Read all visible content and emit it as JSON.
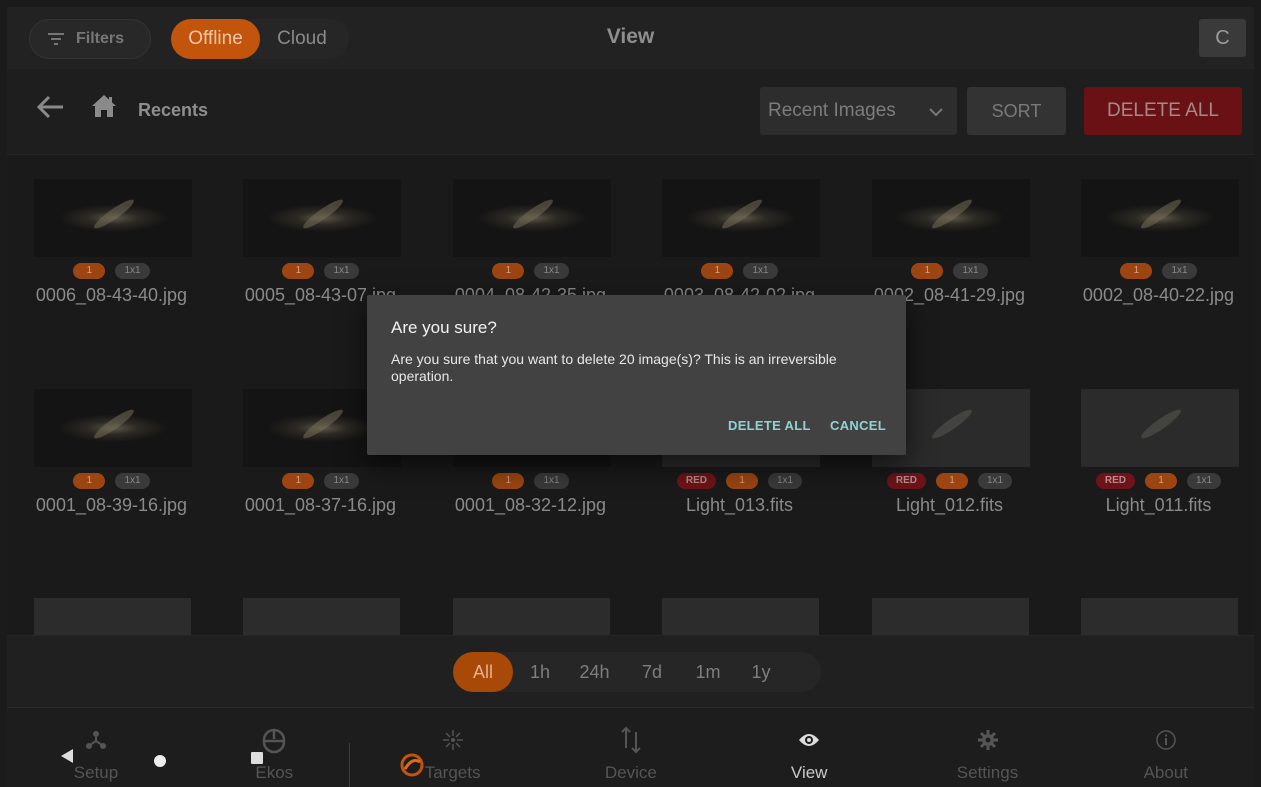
{
  "header": {
    "filters_label": "Filters",
    "offline_label": "Offline",
    "cloud_label": "Cloud",
    "title": "View",
    "refresh_icon": "C"
  },
  "subbar": {
    "breadcrumb": "Recents",
    "select_value": "Recent Images",
    "sort_label": "SORT",
    "delete_all_label": "DELETE ALL"
  },
  "images": [
    {
      "name": "0006_08-43-40.jpg",
      "count": "1",
      "bin": "1x1",
      "filter": ""
    },
    {
      "name": "0005_08-43-07.jpg",
      "count": "1",
      "bin": "1x1",
      "filter": ""
    },
    {
      "name": "0004_08-42-35.jpg",
      "count": "1",
      "bin": "1x1",
      "filter": ""
    },
    {
      "name": "0003_08-42-02.jpg",
      "count": "1",
      "bin": "1x1",
      "filter": ""
    },
    {
      "name": "0002_08-41-29.jpg",
      "count": "1",
      "bin": "1x1",
      "filter": ""
    },
    {
      "name": "0002_08-40-22.jpg",
      "count": "1",
      "bin": "1x1",
      "filter": ""
    },
    {
      "name": "0001_08-39-16.jpg",
      "count": "1",
      "bin": "1x1",
      "filter": ""
    },
    {
      "name": "0001_08-37-16.jpg",
      "count": "1",
      "bin": "1x1",
      "filter": ""
    },
    {
      "name": "0001_08-32-12.jpg",
      "count": "1",
      "bin": "1x1",
      "filter": ""
    },
    {
      "name": "Light_013.fits",
      "count": "1",
      "bin": "1x1",
      "filter": "RED"
    },
    {
      "name": "Light_012.fits",
      "count": "1",
      "bin": "1x1",
      "filter": "RED"
    },
    {
      "name": "Light_011.fits",
      "count": "1",
      "bin": "1x1",
      "filter": "RED"
    }
  ],
  "time_range": [
    "All",
    "1h",
    "24h",
    "7d",
    "1m",
    "1y"
  ],
  "nav": [
    {
      "label": "Setup",
      "icon": "setup-icon"
    },
    {
      "label": "Ekos",
      "icon": "ekos-icon"
    },
    {
      "label": "Targets",
      "icon": "targets-icon"
    },
    {
      "label": "Device",
      "icon": "device-icon"
    },
    {
      "label": "View",
      "icon": "eye-icon"
    },
    {
      "label": "Settings",
      "icon": "gear-icon"
    },
    {
      "label": "About",
      "icon": "info-icon"
    }
  ],
  "dialog": {
    "title": "Are you sure?",
    "message": "Are you sure that you want to delete 20 image(s)? This is an irreversible operation.",
    "confirm_label": "DELETE ALL",
    "cancel_label": "CANCEL"
  },
  "colors": {
    "accent": "#c2540b",
    "danger": "#6a1115",
    "dialog_button": "#8fd3d6"
  }
}
